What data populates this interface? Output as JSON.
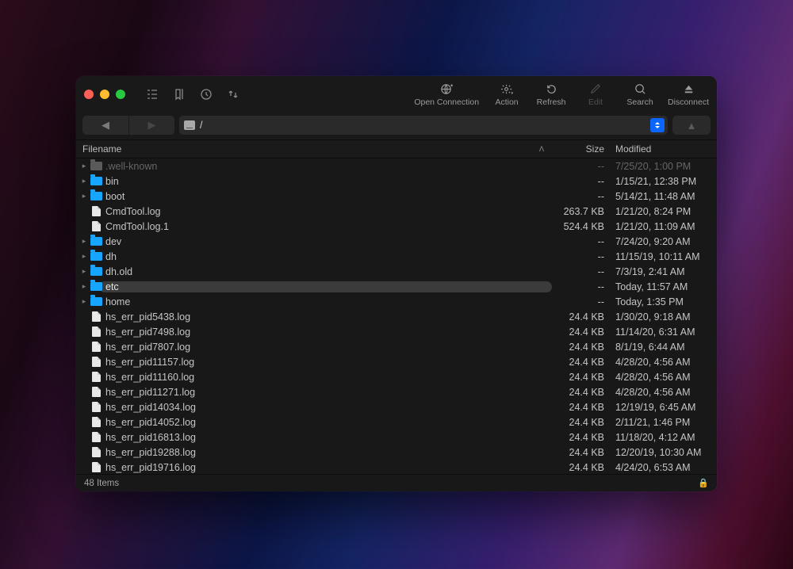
{
  "toolbar": {
    "open_connection": "Open Connection",
    "action": "Action",
    "refresh": "Refresh",
    "edit": "Edit",
    "search": "Search",
    "disconnect": "Disconnect"
  },
  "path": "/",
  "columns": {
    "filename": "Filename",
    "size": "Size",
    "modified": "Modified"
  },
  "files": [
    {
      "folder": true,
      "disclosure": true,
      "name": ".well-known",
      "size": "--",
      "modified": "7/25/20, 1:00 PM",
      "dim": true
    },
    {
      "folder": true,
      "disclosure": true,
      "name": "bin",
      "size": "--",
      "modified": "1/15/21, 12:38 PM"
    },
    {
      "folder": true,
      "disclosure": true,
      "name": "boot",
      "size": "--",
      "modified": "5/14/21, 11:48 AM"
    },
    {
      "folder": false,
      "disclosure": false,
      "name": "CmdTool.log",
      "size": "263.7 KB",
      "modified": "1/21/20, 8:24 PM"
    },
    {
      "folder": false,
      "disclosure": false,
      "name": "CmdTool.log.1",
      "size": "524.4 KB",
      "modified": "1/21/20, 11:09 AM"
    },
    {
      "folder": true,
      "disclosure": true,
      "name": "dev",
      "size": "--",
      "modified": "7/24/20, 9:20 AM"
    },
    {
      "folder": true,
      "disclosure": true,
      "name": "dh",
      "size": "--",
      "modified": "11/15/19, 10:11 AM"
    },
    {
      "folder": true,
      "disclosure": true,
      "name": "dh.old",
      "size": "--",
      "modified": "7/3/19, 2:41 AM"
    },
    {
      "folder": true,
      "disclosure": true,
      "name": "etc",
      "size": "--",
      "modified": "Today, 11:57 AM",
      "selected": true
    },
    {
      "folder": true,
      "disclosure": true,
      "name": "home",
      "size": "--",
      "modified": "Today, 1:35 PM"
    },
    {
      "folder": false,
      "disclosure": false,
      "name": "hs_err_pid5438.log",
      "size": "24.4 KB",
      "modified": "1/30/20, 9:18 AM"
    },
    {
      "folder": false,
      "disclosure": false,
      "name": "hs_err_pid7498.log",
      "size": "24.4 KB",
      "modified": "11/14/20, 6:31 AM"
    },
    {
      "folder": false,
      "disclosure": false,
      "name": "hs_err_pid7807.log",
      "size": "24.4 KB",
      "modified": "8/1/19, 6:44 AM"
    },
    {
      "folder": false,
      "disclosure": false,
      "name": "hs_err_pid11157.log",
      "size": "24.4 KB",
      "modified": "4/28/20, 4:56 AM"
    },
    {
      "folder": false,
      "disclosure": false,
      "name": "hs_err_pid11160.log",
      "size": "24.4 KB",
      "modified": "4/28/20, 4:56 AM"
    },
    {
      "folder": false,
      "disclosure": false,
      "name": "hs_err_pid11271.log",
      "size": "24.4 KB",
      "modified": "4/28/20, 4:56 AM"
    },
    {
      "folder": false,
      "disclosure": false,
      "name": "hs_err_pid14034.log",
      "size": "24.4 KB",
      "modified": "12/19/19, 6:45 AM"
    },
    {
      "folder": false,
      "disclosure": false,
      "name": "hs_err_pid14052.log",
      "size": "24.4 KB",
      "modified": "2/11/21, 1:46 PM"
    },
    {
      "folder": false,
      "disclosure": false,
      "name": "hs_err_pid16813.log",
      "size": "24.4 KB",
      "modified": "11/18/20, 4:12 AM"
    },
    {
      "folder": false,
      "disclosure": false,
      "name": "hs_err_pid19288.log",
      "size": "24.4 KB",
      "modified": "12/20/19, 10:30 AM"
    },
    {
      "folder": false,
      "disclosure": false,
      "name": "hs_err_pid19716.log",
      "size": "24.4 KB",
      "modified": "4/24/20, 6:53 AM"
    }
  ],
  "status": "48 Items"
}
